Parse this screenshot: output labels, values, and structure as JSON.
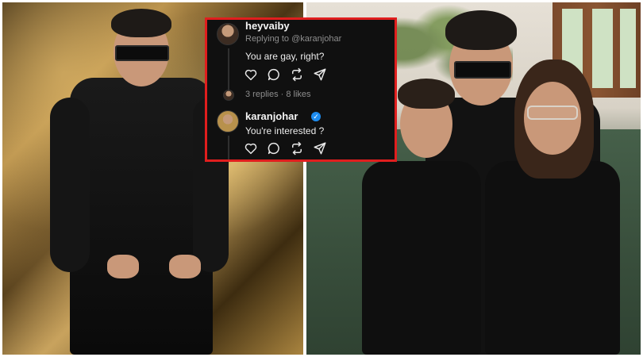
{
  "comment_card": {
    "reply": {
      "username": "heyvaiby",
      "replying_to": "Replying to @karanjohar",
      "text": "You are gay, right?",
      "stats": "3 replies · 8 likes"
    },
    "response": {
      "username": "karanjohar",
      "verified_mark": "✓",
      "text": "You're interested ?"
    },
    "action_icons": [
      "heart-icon",
      "comment-icon",
      "repost-icon",
      "share-icon"
    ]
  },
  "colors": {
    "card_border": "#e01e1e",
    "card_background": "#101010",
    "verified": "#1d8cf0"
  }
}
